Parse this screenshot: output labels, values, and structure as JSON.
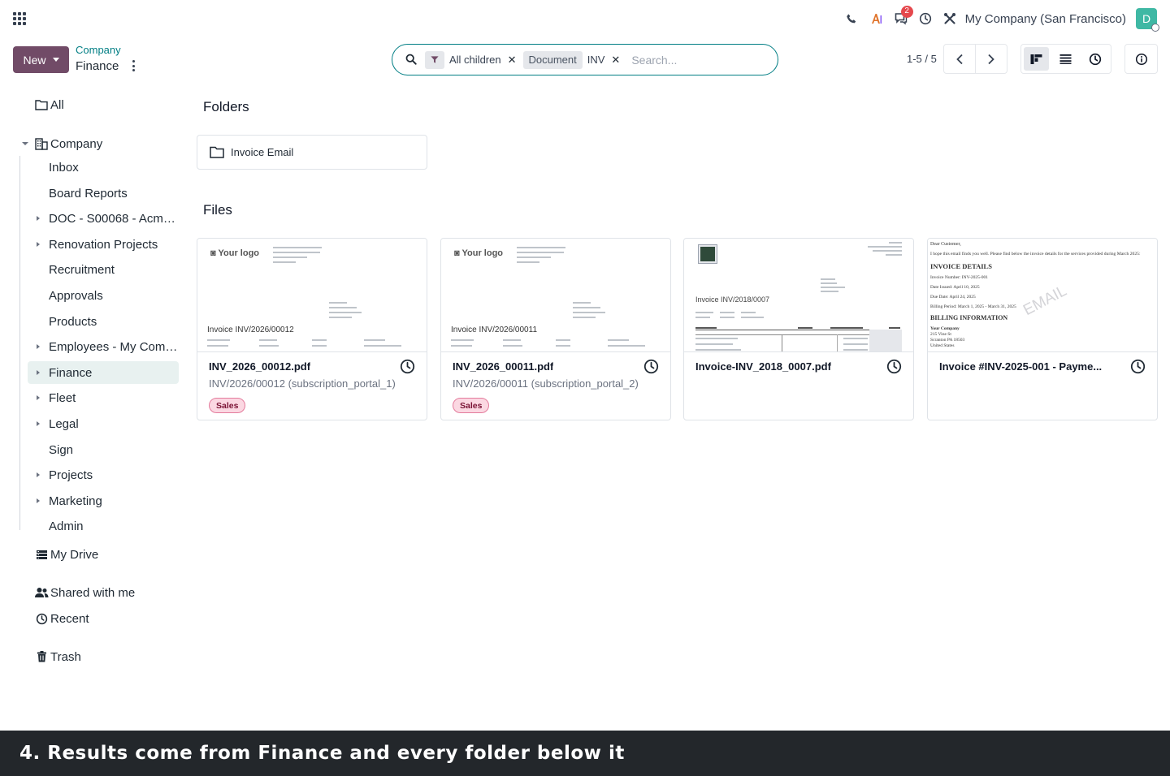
{
  "topbar": {
    "company": "My Company (San Francisco)",
    "avatar_letter": "D",
    "messages_badge": "2"
  },
  "control": {
    "new_label": "New",
    "breadcrumb_parent": "Company",
    "breadcrumb_current": "Finance",
    "search": {
      "facet_filter": "All children",
      "facet_group_label": "Document",
      "facet_group_value": "INV",
      "placeholder": "Search..."
    },
    "pager": "1-5 / 5"
  },
  "sidebar": {
    "all": "All",
    "company": "Company",
    "children": [
      {
        "label": "Inbox",
        "expandable": false
      },
      {
        "label": "Board Reports",
        "expandable": false
      },
      {
        "label": "DOC - S00068 - Acme ...",
        "expandable": true
      },
      {
        "label": "Renovation Projects",
        "expandable": true
      },
      {
        "label": "Recruitment",
        "expandable": false
      },
      {
        "label": "Approvals",
        "expandable": false
      },
      {
        "label": "Products",
        "expandable": false
      },
      {
        "label": "Employees - My Comp...",
        "expandable": true
      },
      {
        "label": "Finance",
        "expandable": true,
        "active": true
      },
      {
        "label": "Fleet",
        "expandable": true
      },
      {
        "label": "Legal",
        "expandable": true
      },
      {
        "label": "Sign",
        "expandable": false
      },
      {
        "label": "Projects",
        "expandable": true
      },
      {
        "label": "Marketing",
        "expandable": true
      },
      {
        "label": "Admin",
        "expandable": false
      }
    ],
    "my_drive": "My Drive",
    "shared": "Shared with me",
    "recent": "Recent",
    "trash": "Trash"
  },
  "main": {
    "folders_title": "Folders",
    "folders": [
      {
        "name": "Invoice Email"
      }
    ],
    "files_title": "Files",
    "files": [
      {
        "name": "INV_2026_00012.pdf",
        "description": "INV/2026/00012 (subscription_portal_1)",
        "tag": "Sales"
      },
      {
        "name": "INV_2026_00011.pdf",
        "description": "INV/2026/00011 (subscription_portal_2)",
        "tag": "Sales"
      },
      {
        "name": "Invoice-INV_2018_0007.pdf",
        "description": "",
        "tag": ""
      },
      {
        "name": "Invoice #INV-2025-001 - Payme...",
        "description": "",
        "tag": ""
      }
    ],
    "thumbs": {
      "logo_text": "Your logo",
      "t1_title": "Invoice INV/2026/00012",
      "t2_title": "Invoice INV/2026/00011",
      "t3_title": "Invoice INV/2018/0007",
      "t4_greeting": "Dear Customer,",
      "t4_intro": "I hope this email finds you well. Please find below the invoice details for the services provided during March 2025:",
      "t4_heading": "INVOICE DETAILS",
      "t4_l1": "Invoice Number: INV-2025-001",
      "t4_l2": "Date Issued: April 10, 2025",
      "t4_l3": "Due Date: April 24, 2025",
      "t4_l4": "Billing Period: March 1, 2025 - March 31, 2025",
      "t4_heading2": "BILLING INFORMATION",
      "t4_b1": "Your Company",
      "t4_b2": "215 Vine St",
      "t4_b3": "Scranton PA 18503",
      "t4_b4": "United States",
      "t4_watermark": "EMAIL"
    }
  },
  "caption": "4. Results come from Finance and every folder below it"
}
